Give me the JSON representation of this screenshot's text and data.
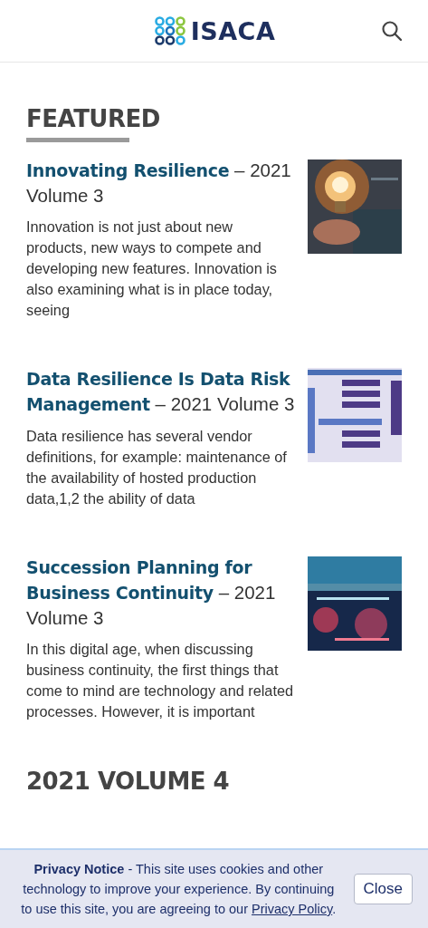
{
  "header": {
    "logo_text": "ISACA"
  },
  "featured": {
    "heading": "FEATURED",
    "articles": [
      {
        "title": "Innovating Resilience",
        "issue": "– 2021 Volume 3",
        "excerpt": "Innovation is not just about new products, new ways to compete and developing new features. Innovation is also examining what is in place today, seeing"
      },
      {
        "title": "Data Resilience Is Data Risk Management",
        "issue": "– 2021 Volume 3",
        "excerpt": "Data resilience has several vendor definitions, for example: maintenance of the availability of hosted production data,1,2 the ability of data"
      },
      {
        "title": "Succession Planning for Business Continuity",
        "issue": "– 2021 Volume 3",
        "excerpt": "In this digital age, when discussing business continuity, the first things that come to mind are technology and related processes. However, it is important"
      }
    ]
  },
  "next_section": {
    "heading": "2021 VOLUME 4"
  },
  "privacy_banner": {
    "text": "**Privacy Notice** - This site uses cookies and other technology to improve your experience. By continuing to use this site, you are agreeing to our ",
    "link": "Privacy Policy",
    "after": ".",
    "button": "Close"
  }
}
